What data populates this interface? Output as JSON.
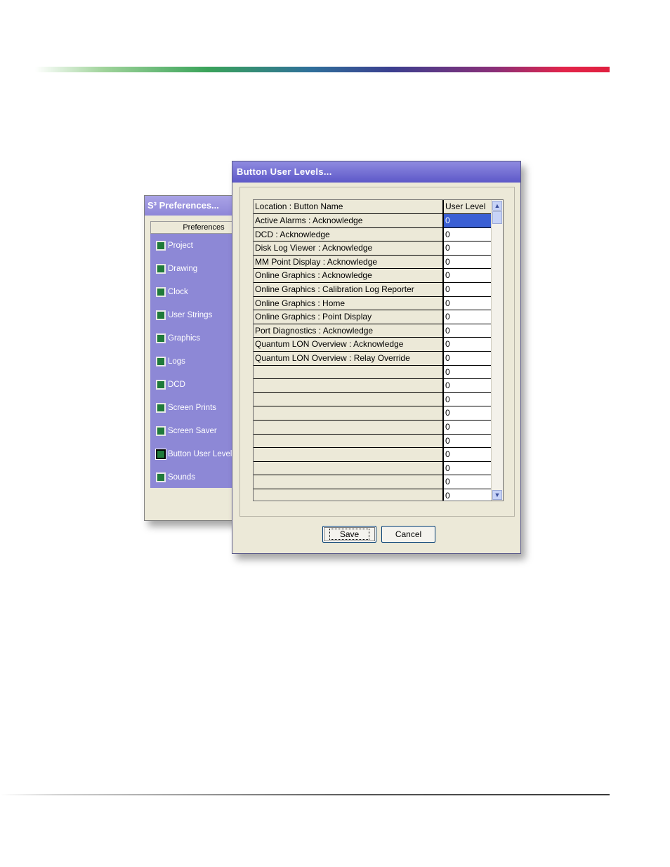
{
  "preferences_window": {
    "title": "S³ Preferences...",
    "panel_header": "Preferences",
    "items": [
      {
        "label": "Project"
      },
      {
        "label": "Drawing"
      },
      {
        "label": "Clock"
      },
      {
        "label": "User Strings"
      },
      {
        "label": "Graphics"
      },
      {
        "label": "Logs"
      },
      {
        "label": "DCD"
      },
      {
        "label": "Screen Prints"
      },
      {
        "label": "Screen Saver"
      },
      {
        "label": "Button User Levels"
      },
      {
        "label": "Sounds"
      }
    ],
    "selected_item": "Button User Levels"
  },
  "button_user_levels_dialog": {
    "title": "Button User Levels...",
    "columns": {
      "name": "Location : Button Name",
      "level": "User Level"
    },
    "rows": [
      {
        "name": "Active Alarms : Acknowledge",
        "level": "0"
      },
      {
        "name": "DCD : Acknowledge",
        "level": "0"
      },
      {
        "name": "Disk Log Viewer : Acknowledge",
        "level": "0"
      },
      {
        "name": "MM Point Display : Acknowledge",
        "level": "0"
      },
      {
        "name": "Online Graphics : Acknowledge",
        "level": "0"
      },
      {
        "name": "Online Graphics : Calibration Log Reporter",
        "level": "0"
      },
      {
        "name": "Online Graphics : Home",
        "level": "0"
      },
      {
        "name": "Online Graphics : Point Display",
        "level": "0"
      },
      {
        "name": "Port Diagnostics : Acknowledge",
        "level": "0"
      },
      {
        "name": "Quantum LON Overview : Acknowledge",
        "level": "0"
      },
      {
        "name": "Quantum LON Overview : Relay Override",
        "level": "0"
      },
      {
        "name": "",
        "level": "0"
      },
      {
        "name": "",
        "level": "0"
      },
      {
        "name": "",
        "level": "0"
      },
      {
        "name": "",
        "level": "0"
      },
      {
        "name": "",
        "level": "0"
      },
      {
        "name": "",
        "level": "0"
      },
      {
        "name": "",
        "level": "0"
      },
      {
        "name": "",
        "level": "0"
      },
      {
        "name": "",
        "level": "0"
      },
      {
        "name": "",
        "level": "0"
      }
    ],
    "selected_row": 0,
    "save_label": "Save",
    "cancel_label": "Cancel"
  },
  "icons": {
    "scroll_up": "scroll-up-arrow-icon",
    "scroll_down": "scroll-down-arrow-icon",
    "preference_item": "green-square-icon"
  },
  "colors": {
    "title_bar": "#5d58c8",
    "panel": "#8d88d6",
    "selection": "#3a5fd4",
    "item_square": "#1f7a3a"
  }
}
